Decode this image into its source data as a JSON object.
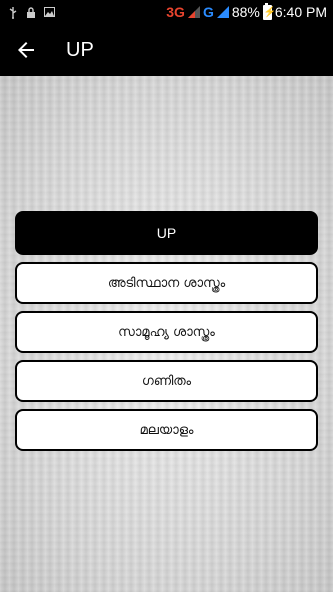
{
  "status_bar": {
    "network_3g": "3G",
    "network_g": "G",
    "battery_percent": "88%",
    "time": "6:40 PM",
    "icons": [
      "usb-icon",
      "lock-icon",
      "image-icon"
    ],
    "colors": {
      "network_3g": "#e8442e",
      "network_g": "#2b8cff"
    }
  },
  "app_bar": {
    "title": "UP",
    "back_icon": "arrow-left-icon"
  },
  "menu": {
    "header_label": "UP",
    "items": [
      {
        "label": "അടിസ്ഥാന ശാസ്ത്രം"
      },
      {
        "label": "സാമൂഹ്യ ശാസ്ത്രം"
      },
      {
        "label": "ഗണിതം"
      },
      {
        "label": "മലയാളം"
      }
    ]
  }
}
